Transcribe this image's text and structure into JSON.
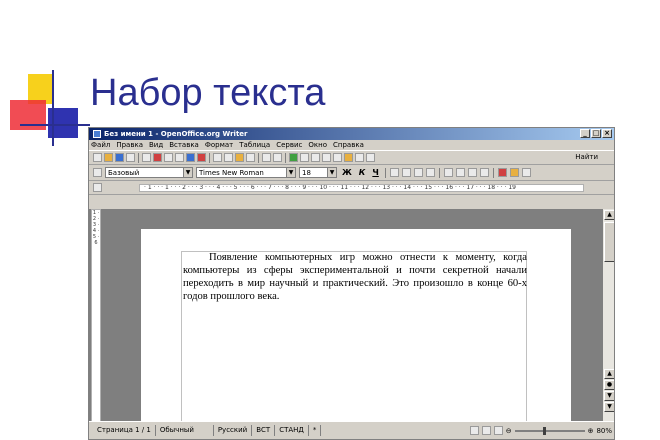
{
  "slide": {
    "title": "Набор текста"
  },
  "window": {
    "title": "Без имени 1 - OpenOffice.org Writer",
    "controls": {
      "minimize": "_",
      "maximize": "□",
      "close": "×"
    }
  },
  "menu": [
    "Файл",
    "Правка",
    "Вид",
    "Вставка",
    "Формат",
    "Таблица",
    "Сервис",
    "Окно",
    "Справка"
  ],
  "toolbar": {
    "find_label": "Найти"
  },
  "format_bar": {
    "style": "Базовый",
    "font": "Times New Roman",
    "size": "18",
    "bold": "Ж",
    "italic": "К",
    "underline": "Ч"
  },
  "ruler": {
    "ticks": "· 1 · · · 1 · · · 2 · · · 3 · · · 4 · · · 5 · · · 6 · · · 7 · · · 8 · · · 9 · · · 10 · · · 11 · · · 12 · · · 13 · · · 14 · · · 15 · · · 16 · · · 17 · · · 18 · · · 19"
  },
  "vertical_ruler": "1 · 2 · 3 · 4 · 5 · 6",
  "document": {
    "paragraph": "Появление компьютерных игр можно отнести к моменту, когда компьютеры из сферы экспериментальной и почти секретной начали переходить в мир научный и практический. Это произошло в конце 60-х годов прошлого века."
  },
  "status": {
    "page": "Страница  1 / 1",
    "style": "Обычный",
    "language": "Русский",
    "insert_mode": "ВСТ",
    "selection_mode": "СТАНД",
    "modified": "*",
    "zoom": "80%"
  },
  "colors": {
    "title": "#2a2f8f",
    "square_yellow": "#f7d11c",
    "square_red": "#ee2d36",
    "square_blue": "#2f33b0"
  }
}
